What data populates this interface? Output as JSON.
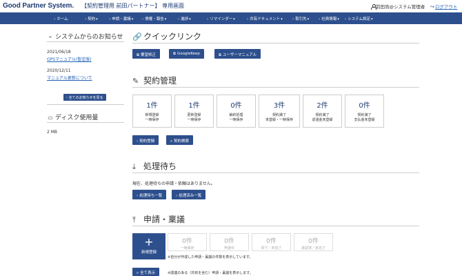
{
  "header": {
    "logo": "Good Partner System.",
    "title": "【契約管理用 前田パートナー】 専用画面",
    "user": "前田尚@システム管理者",
    "logout": "ログアウト"
  },
  "nav": [
    "ホーム",
    "契約",
    "申請・稟議",
    "債権・報告",
    "進捗",
    "リマインダー",
    "共有ドキュメント",
    "取引先",
    "社員情報",
    "システム設定"
  ],
  "sidebar": {
    "notice_title": "システムからのお知らせ",
    "notices": [
      {
        "date": "2021/06/18",
        "link": "GPSマニュアル(暫定版)"
      },
      {
        "date": "2020/12/11",
        "link": "マニュアル更新について"
      }
    ],
    "all_notices_button": "全てのお知らせを見る",
    "disk_title": "ディスク使用量",
    "disk_value": "2 MB"
  },
  "quicklink": {
    "title": "クイックリンク",
    "buttons": [
      "要望修正",
      "GoogleKeep",
      "ユーザーマニュアル"
    ]
  },
  "contract": {
    "title": "契約管理",
    "cards": [
      {
        "num": "1件",
        "l1": "新規登録",
        "l2": "一時保存"
      },
      {
        "num": "1件",
        "l1": "更新登録",
        "l2": "一時保存"
      },
      {
        "num": "0件",
        "l1": "解約処理",
        "l2": "一時保存"
      },
      {
        "num": "3件",
        "l1": "契約満了",
        "l2": "未登録・一時保存"
      },
      {
        "num": "2件",
        "l1": "契約満了",
        "l2": "返還金未登録"
      },
      {
        "num": "0件",
        "l1": "契約満了",
        "l2": "支払金未登録"
      }
    ],
    "register_button": "契約登録",
    "search_button": "契約検索"
  },
  "pending": {
    "title": "処理待ち",
    "message": "現在、処理待ちの申請・依頼はありません。",
    "list_button": "処理待ち一覧",
    "done_button": "処理済み一覧"
  },
  "approval": {
    "title": "申請・稟議",
    "new_label": "新規登録",
    "cards": [
      {
        "num": "0件",
        "lbl": "一時保存"
      },
      {
        "num": "0件",
        "lbl": "申請中"
      },
      {
        "num": "0件",
        "lbl": "却下／未完了"
      },
      {
        "num": "0件",
        "lbl": "承認済／未完了"
      }
    ],
    "note1": "※自分が作成した申請・稟議の件数を表示しています。",
    "show_all_button": "全て表示",
    "note2": "※関連のある（共有を含む）申請・稟議を表示します。"
  },
  "colors": {
    "brand": "#2d4f8d",
    "link": "#1f5fb5"
  }
}
